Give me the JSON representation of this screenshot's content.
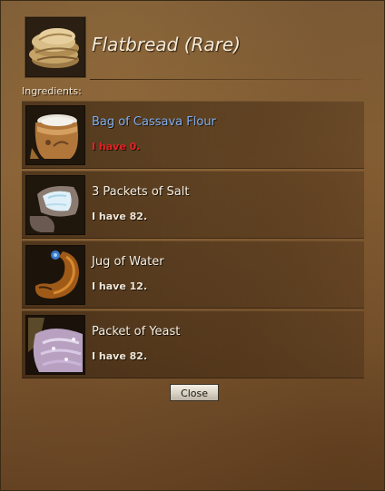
{
  "recipe": {
    "title": "Flatbread (Rare)",
    "icon": "flatbread-icon"
  },
  "ingredients_label": "Ingredients:",
  "ingredients": [
    {
      "name": "Bag of Cassava Flour",
      "have": "I have 0.",
      "icon": "flour-bag-icon",
      "name_color": "#7fb0f0",
      "have_color": "#e22424"
    },
    {
      "name": "3 Packets of Salt",
      "have": "I have 82.",
      "icon": "salt-packet-icon"
    },
    {
      "name": "Jug of Water",
      "have": "I have 12.",
      "icon": "water-jug-icon"
    },
    {
      "name": "Packet of Yeast",
      "have": "I have 82.",
      "icon": "yeast-packet-icon"
    }
  ],
  "close_label": "Close"
}
